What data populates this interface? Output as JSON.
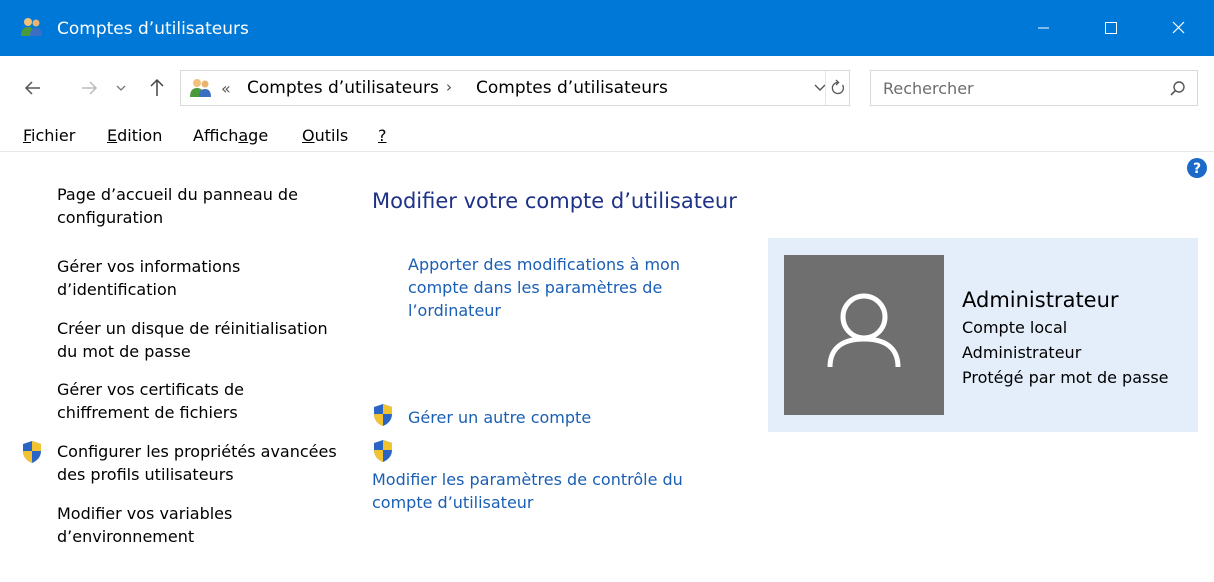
{
  "window": {
    "title": "Comptes d’utilisateurs",
    "accent": "#0078d7"
  },
  "address": {
    "overflow_chevron": "«",
    "breadcrumb": [
      "Comptes d’utilisateurs",
      "Comptes d’utilisateurs"
    ],
    "separator": "›"
  },
  "search": {
    "placeholder": "Rechercher"
  },
  "menu": [
    {
      "mnemonic": "F",
      "rest": "ichier"
    },
    {
      "mnemonic": "E",
      "rest": "dition"
    },
    {
      "before": "Affich",
      "mnemonic": "a",
      "rest": "ge"
    },
    {
      "mnemonic": "O",
      "rest": "utils"
    },
    {
      "mnemonic": "?",
      "rest": ""
    }
  ],
  "leftnav": {
    "items": [
      {
        "label": "Page d’accueil du panneau de configuration",
        "shield": false
      },
      {
        "label": "Gérer vos informations d’identification",
        "shield": false
      },
      {
        "label": "Créer un disque de réinitialisation du mot de passe",
        "shield": false
      },
      {
        "label": "Gérer vos certificats de chiffrement de fichiers",
        "shield": false
      },
      {
        "label": "Configurer les propriétés avancées des profils utilisateurs",
        "shield": true
      },
      {
        "label": "Modifier vos variables d’environnement",
        "shield": false
      }
    ]
  },
  "main": {
    "title": "Modifier votre compte d’utilisateur",
    "links": {
      "settings": "Apporter des modifications à mon compte dans les paramètres de l’ordinateur",
      "manage_other": "Gérer un autre compte",
      "uac": "Modifier les paramètres de contrôle du compte d’utilisateur"
    }
  },
  "account": {
    "name": "Administrateur",
    "type": "Compte local",
    "role": "Administrateur",
    "protection": "Protégé par mot de passe"
  },
  "colors": {
    "link": "#1a5fb4",
    "heading": "#1e3287",
    "panel": "#e3eefa",
    "avatar": "#6f6f6f"
  }
}
